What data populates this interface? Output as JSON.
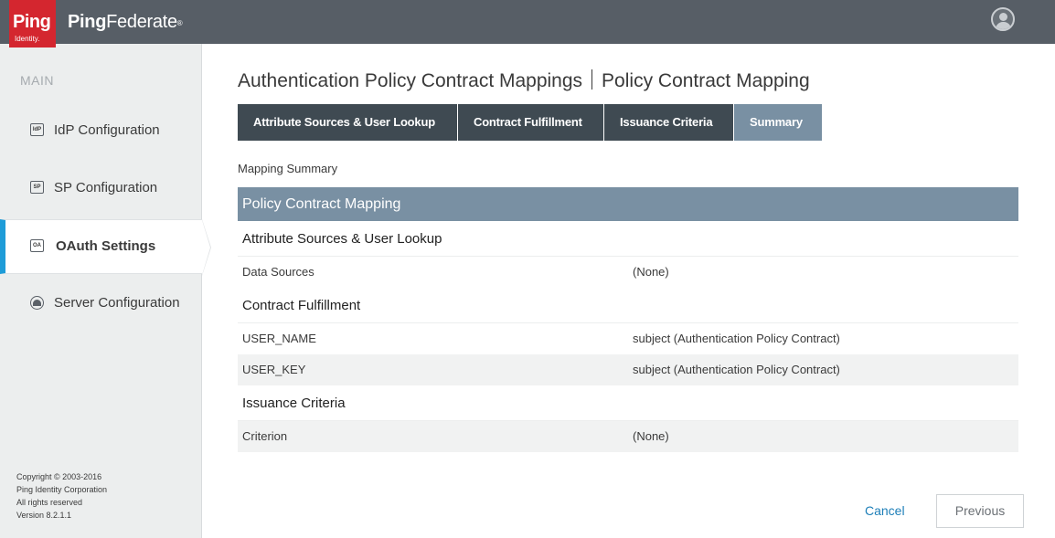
{
  "header": {
    "logo_main": "Ping",
    "logo_sub": "Identity.",
    "product_bold": "Ping",
    "product_rest": "Federate",
    "product_mark": "®"
  },
  "sidebar": {
    "heading": "MAIN",
    "items": [
      {
        "icon_text": "IdP",
        "label": "IdP Configuration"
      },
      {
        "icon_text": "SP",
        "label": "SP Configuration"
      },
      {
        "icon_text": "OA",
        "label": "OAuth Settings"
      },
      {
        "icon_text": "",
        "label": "Server Configuration"
      }
    ],
    "copyright": {
      "line1": "Copyright © 2003-2016",
      "line2": "Ping Identity Corporation",
      "line3": "All rights reserved",
      "line4": "Version 8.2.1.1"
    }
  },
  "main": {
    "title_left": "Authentication Policy Contract Mappings",
    "title_right": "Policy Contract Mapping",
    "tabs": [
      {
        "label": "Attribute Sources & User Lookup"
      },
      {
        "label": "Contract Fulfillment"
      },
      {
        "label": "Issuance Criteria"
      },
      {
        "label": "Summary"
      }
    ],
    "mapping_summary_label": "Mapping Summary",
    "table": {
      "header": "Policy Contract Mapping",
      "sections": [
        {
          "title": "Attribute Sources & User Lookup",
          "rows": [
            {
              "key": "Data Sources",
              "value": "(None)"
            }
          ]
        },
        {
          "title": "Contract Fulfillment",
          "rows": [
            {
              "key": "USER_NAME",
              "value": "subject (Authentication Policy Contract)"
            },
            {
              "key": "USER_KEY",
              "value": "subject (Authentication Policy Contract)"
            }
          ]
        },
        {
          "title": "Issuance Criteria",
          "rows": [
            {
              "key": "Criterion",
              "value": "(None)"
            }
          ]
        }
      ]
    },
    "actions": {
      "cancel_label": "Cancel",
      "previous_label": "Previous"
    }
  }
}
